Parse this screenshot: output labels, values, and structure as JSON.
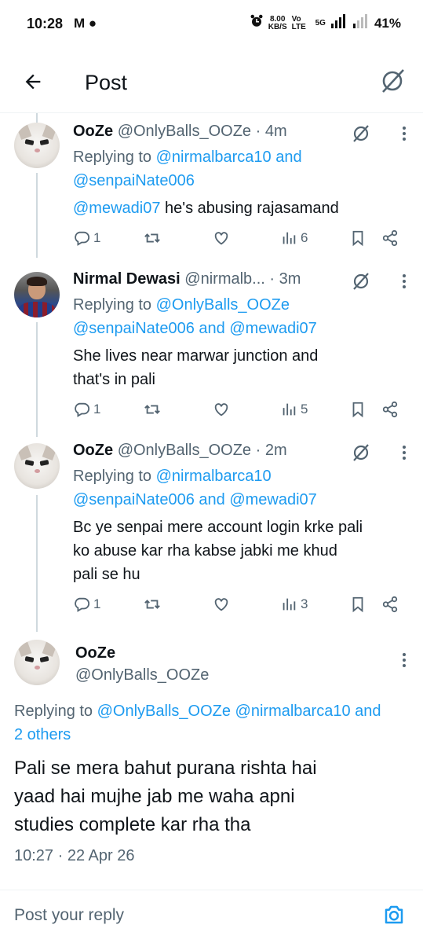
{
  "status_bar": {
    "time": "10:28",
    "app_icons": "M ●",
    "speed_value": "8.00",
    "speed_unit": "KB/S",
    "network": "Vo LTE",
    "network_gen": "5G",
    "battery": "41%"
  },
  "header": {
    "title": "Post",
    "icons": [
      "back-arrow-icon",
      "grok-icon"
    ]
  },
  "tweets": [
    {
      "name": "OoZe",
      "handle": "@OnlyBalls_OOZe",
      "time": "· 4m",
      "replying_prefix": "Replying to ",
      "replying_line1": "@nirmalbarca10 and",
      "replying_line2": "@senpaiNate006",
      "mention": "@mewadi07",
      "text": " he's abusing rajasamand",
      "replies": "1",
      "retweets": "",
      "likes": "",
      "views": "6"
    },
    {
      "name": "Nirmal Dewasi",
      "handle": "@nirmalb...",
      "time": "· 3m",
      "replying_prefix": "Replying to ",
      "replying_line1": "@OnlyBalls_OOZe",
      "replying_line2": "@senpaiNate006 and @mewadi07",
      "text_line1": "She lives near marwar junction and",
      "text_line2": "that's in pali",
      "replies": "1",
      "retweets": "",
      "likes": "",
      "views": "5"
    },
    {
      "name": "OoZe",
      "handle": "@OnlyBalls_OOZe",
      "time": "· 2m",
      "replying_prefix": "Replying to ",
      "replying_line1": "@nirmalbarca10",
      "replying_line2": "@senpaiNate006 and @mewadi07",
      "text_line1": "Bc ye senpai mere account login krke pali",
      "text_line2": "ko abuse kar rha kabse jabki me khud",
      "text_line3": "pali se hu",
      "replies": "1",
      "retweets": "",
      "likes": "",
      "views": "3"
    }
  ],
  "main_post": {
    "name": "OoZe",
    "handle": "@OnlyBalls_OOZe",
    "replying_prefix": "Replying to ",
    "replying_mentions": "@OnlyBalls_OOZe @nirmalbarca10 and",
    "replying_line2": "2 others",
    "text_line1": "Pali se mera bahut purana rishta hai",
    "text_line2": "yaad hai mujhe jab me waha apni",
    "text_line3": "studies complete kar rha tha",
    "timestamp": "10:27 · 22 Apr 26"
  },
  "reply_bar": {
    "placeholder": "Post your reply"
  },
  "colors": {
    "text": "#0f1419",
    "secondary": "#536471",
    "link": "#1d9bf0",
    "divider": "#eff3f4"
  }
}
